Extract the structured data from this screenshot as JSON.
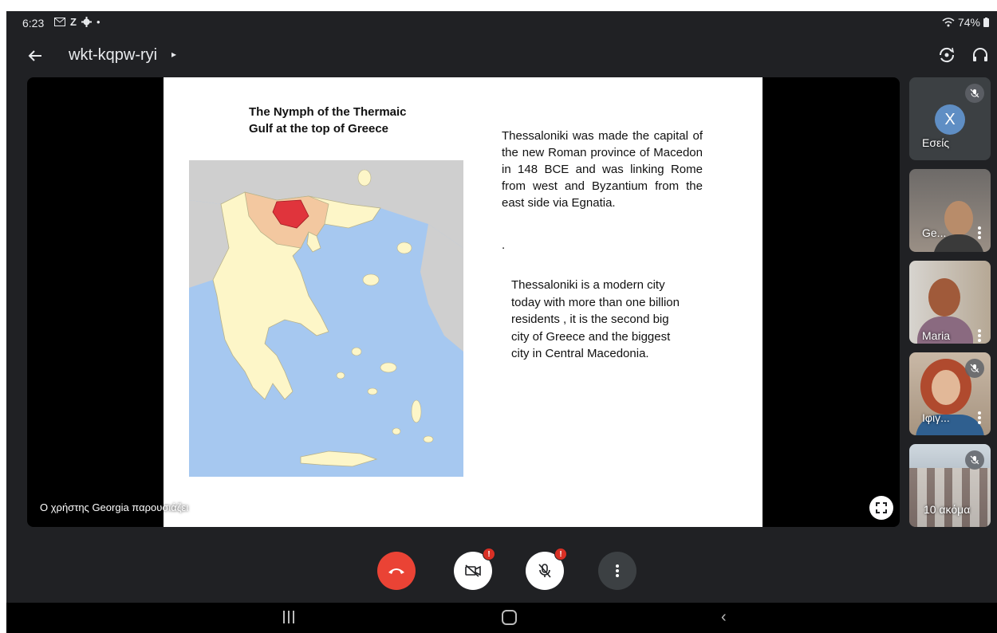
{
  "status_bar": {
    "time": "6:23",
    "battery": "74%",
    "icons": [
      "gmail-icon",
      "zoom-z-icon",
      "settings-icon",
      "dot-icon",
      "wifi-icon",
      "battery-icon"
    ]
  },
  "header": {
    "meeting_code": "wkt-kqpw-ryi",
    "caret": "▸",
    "icons": [
      "back-arrow-icon",
      "switch-camera-icon",
      "headphones-icon"
    ]
  },
  "slide": {
    "title": "The Nymph of the Thermaic Gulf at the top of Greece",
    "paragraph1": "Thessaloniki was made the capital of the new Roman province of Macedon in 148 BCE and was linking Rome from west and Byzantium from the east side via Egnatia.",
    "paragraph1_dot": ".",
    "paragraph2": "Thessaloniki is a modern city today with more than one billion residents , it is the second big city of Greece and the biggest city in Central Macedonia."
  },
  "presenter_label": "Ο χρήστης Georgia παρουσιάζει",
  "participants": [
    {
      "name": "Εσείς",
      "avatar_letter": "X",
      "muted": true
    },
    {
      "name": "Ge...",
      "muted": false
    },
    {
      "name": "Maria",
      "muted": false
    },
    {
      "name": "Ιφιγ...",
      "muted": true
    },
    {
      "name": "10 ακόμα",
      "muted": true
    }
  ],
  "controls": {
    "end_call": "end-call-icon",
    "camera": "camera-off-icon",
    "mic": "mic-off-icon",
    "more": "more-vert-icon",
    "alert_symbol": "!"
  },
  "colors": {
    "background": "#202124",
    "end_call": "#ea4335",
    "alert": "#d93025",
    "map_sea": "#a6c8f0",
    "map_land": "#fdf6c8",
    "map_region_highlight": "#e0343c",
    "map_region_light": "#f3c8a0"
  }
}
